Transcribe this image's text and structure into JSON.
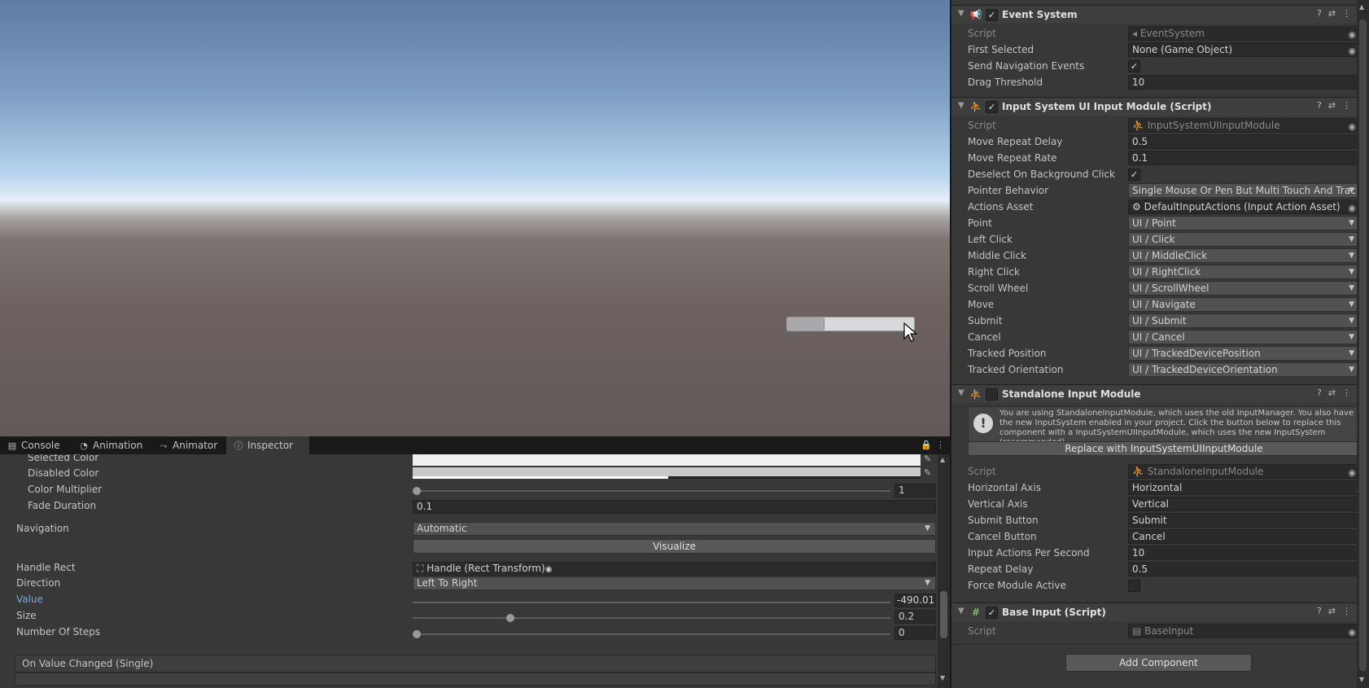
{
  "bottom_tabs": [
    {
      "label": "Console",
      "icon": "console-icon"
    },
    {
      "label": "Animation",
      "icon": "animation-icon"
    },
    {
      "label": "Animator",
      "icon": "animator-icon"
    },
    {
      "label": "Inspector",
      "icon": "info-icon"
    }
  ],
  "slider_inspector": {
    "selected_color_label": "Selected Color",
    "disabled_color_label": "Disabled Color",
    "color_multiplier_label": "Color Multiplier",
    "color_multiplier_value": "1",
    "fade_duration_label": "Fade Duration",
    "fade_duration_value": "0.1",
    "navigation_label": "Navigation",
    "navigation_value": "Automatic",
    "visualize_label": "Visualize",
    "handle_rect_label": "Handle Rect",
    "handle_rect_value": "Handle (Rect Transform)",
    "direction_label": "Direction",
    "direction_value": "Left To Right",
    "value_label": "Value",
    "value_value": "-490.01",
    "size_label": "Size",
    "size_value": "0.2",
    "steps_label": "Number Of Steps",
    "steps_value": "0",
    "on_value_changed": "On Value Changed (Single)"
  },
  "event_system": {
    "title": "Event System",
    "script_label": "Script",
    "script_value": "EventSystem",
    "first_selected_label": "First Selected",
    "first_selected_value": "None (Game Object)",
    "send_nav_label": "Send Navigation Events",
    "drag_threshold_label": "Drag Threshold",
    "drag_threshold_value": "10"
  },
  "input_module": {
    "title": "Input System UI Input Module (Script)",
    "rows": [
      {
        "label": "Script",
        "value": "InputSystemUIInputModule",
        "kind": "script"
      },
      {
        "label": "Move Repeat Delay",
        "value": "0.5",
        "kind": "field"
      },
      {
        "label": "Move Repeat Rate",
        "value": "0.1",
        "kind": "field"
      },
      {
        "label": "Deselect On Background Click",
        "value": "",
        "kind": "check"
      },
      {
        "label": "Pointer Behavior",
        "value": "Single Mouse Or Pen But Multi Touch And Track",
        "kind": "dropdown"
      },
      {
        "label": "Actions Asset",
        "value": "DefaultInputActions (Input Action Asset)",
        "kind": "object"
      },
      {
        "label": "Point",
        "value": "UI / Point",
        "kind": "dropdown"
      },
      {
        "label": "Left Click",
        "value": "UI / Click",
        "kind": "dropdown"
      },
      {
        "label": "Middle Click",
        "value": "UI / MiddleClick",
        "kind": "dropdown"
      },
      {
        "label": "Right Click",
        "value": "UI / RightClick",
        "kind": "dropdown"
      },
      {
        "label": "Scroll Wheel",
        "value": "UI / ScrollWheel",
        "kind": "dropdown"
      },
      {
        "label": "Move",
        "value": "UI / Navigate",
        "kind": "dropdown"
      },
      {
        "label": "Submit",
        "value": "UI / Submit",
        "kind": "dropdown"
      },
      {
        "label": "Cancel",
        "value": "UI / Cancel",
        "kind": "dropdown"
      },
      {
        "label": "Tracked Position",
        "value": "UI / TrackedDevicePosition",
        "kind": "dropdown"
      },
      {
        "label": "Tracked Orientation",
        "value": "UI / TrackedDeviceOrientation",
        "kind": "dropdown"
      }
    ]
  },
  "standalone": {
    "title": "Standalone Input Module",
    "warning": "You are using StandaloneInputModule, which uses the old InputManager. You also have the new InputSystem enabled in your project. Click the button below to replace this component with a InputSystemUIInputModule, which uses the new InputSystem (recommended).",
    "replace_button": "Replace with InputSystemUIInputModule",
    "rows": [
      {
        "label": "Script",
        "value": "StandaloneInputModule",
        "kind": "script"
      },
      {
        "label": "Horizontal Axis",
        "value": "Horizontal",
        "kind": "field"
      },
      {
        "label": "Vertical Axis",
        "value": "Vertical",
        "kind": "field"
      },
      {
        "label": "Submit Button",
        "value": "Submit",
        "kind": "field"
      },
      {
        "label": "Cancel Button",
        "value": "Cancel",
        "kind": "field"
      },
      {
        "label": "Input Actions Per Second",
        "value": "10",
        "kind": "field"
      },
      {
        "label": "Repeat Delay",
        "value": "0.5",
        "kind": "field"
      },
      {
        "label": "Force Module Active",
        "value": "",
        "kind": "check-off"
      }
    ]
  },
  "base_input": {
    "title": "Base Input (Script)",
    "script_label": "Script",
    "script_value": "BaseInput"
  },
  "add_component": "Add Component",
  "colors": {
    "accent_value_label": "#7aa6e0",
    "panel": "#383838",
    "field": "#2a2a2a"
  }
}
